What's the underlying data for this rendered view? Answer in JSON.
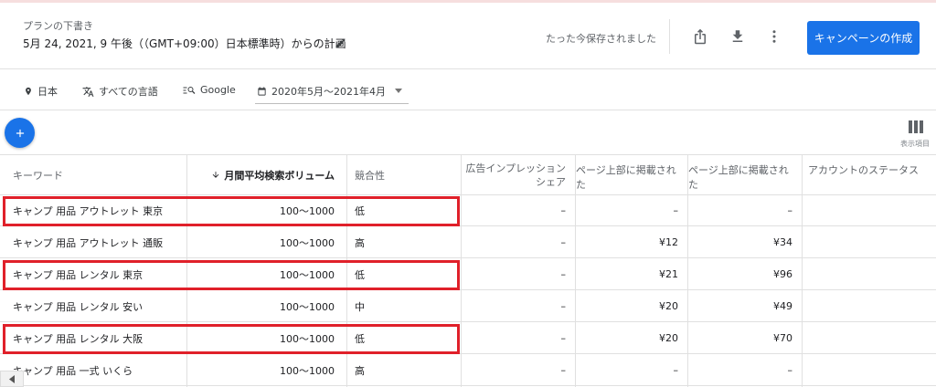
{
  "header": {
    "plan_label": "プランの下書き",
    "plan_title": "5月 24, 2021, 9 午後（（GMT+09:00）日本標準時）からの計画",
    "saved_status": "たった今保存されました",
    "create_button": "キャンペーンの作成"
  },
  "filters": {
    "country": "日本",
    "language": "すべての言語",
    "network": "Google",
    "date_range": "2020年5月～2021年4月"
  },
  "toolbar": {
    "columns_label": "表示項目"
  },
  "table": {
    "headers": {
      "keyword": "キーワード",
      "volume": "月間平均検索ボリューム",
      "competition": "競合性",
      "impression_share": "広告インプレッション シェア",
      "low_bid": "ページ上部に掲載された",
      "high_bid": "ページ上部に掲載された",
      "account_status": "アカウントのステータス"
    },
    "rows": [
      {
        "keyword": "キャンプ 用品 アウトレット 東京",
        "volume": "100～1000",
        "competition": "低",
        "impression_share": "–",
        "low_bid": "–",
        "high_bid": "–",
        "highlighted": true
      },
      {
        "keyword": "キャンプ 用品 アウトレット 通販",
        "volume": "100～1000",
        "competition": "高",
        "impression_share": "–",
        "low_bid": "¥12",
        "high_bid": "¥34",
        "highlighted": false
      },
      {
        "keyword": "キャンプ 用品 レンタル 東京",
        "volume": "100～1000",
        "competition": "低",
        "impression_share": "–",
        "low_bid": "¥21",
        "high_bid": "¥96",
        "highlighted": true
      },
      {
        "keyword": "キャンプ 用品 レンタル 安い",
        "volume": "100～1000",
        "competition": "中",
        "impression_share": "–",
        "low_bid": "¥20",
        "high_bid": "¥49",
        "highlighted": false
      },
      {
        "keyword": "キャンプ 用品 レンタル 大阪",
        "volume": "100～1000",
        "competition": "低",
        "impression_share": "–",
        "low_bid": "¥20",
        "high_bid": "¥70",
        "highlighted": true
      },
      {
        "keyword": "キャンプ 用品 一式 いくら",
        "volume": "100～1000",
        "competition": "高",
        "impression_share": "–",
        "low_bid": "–",
        "high_bid": "–",
        "highlighted": false
      }
    ]
  },
  "colors": {
    "accent": "#1a73e8",
    "highlight_border": "#e0202a"
  },
  "icons": [
    "pencil-icon",
    "share-icon",
    "download-icon",
    "more-vert-icon",
    "location-pin-icon",
    "translate-icon",
    "search-network-icon",
    "calendar-icon",
    "plus-icon",
    "columns-icon",
    "sort-arrow-down-icon",
    "chevron-left-icon"
  ]
}
